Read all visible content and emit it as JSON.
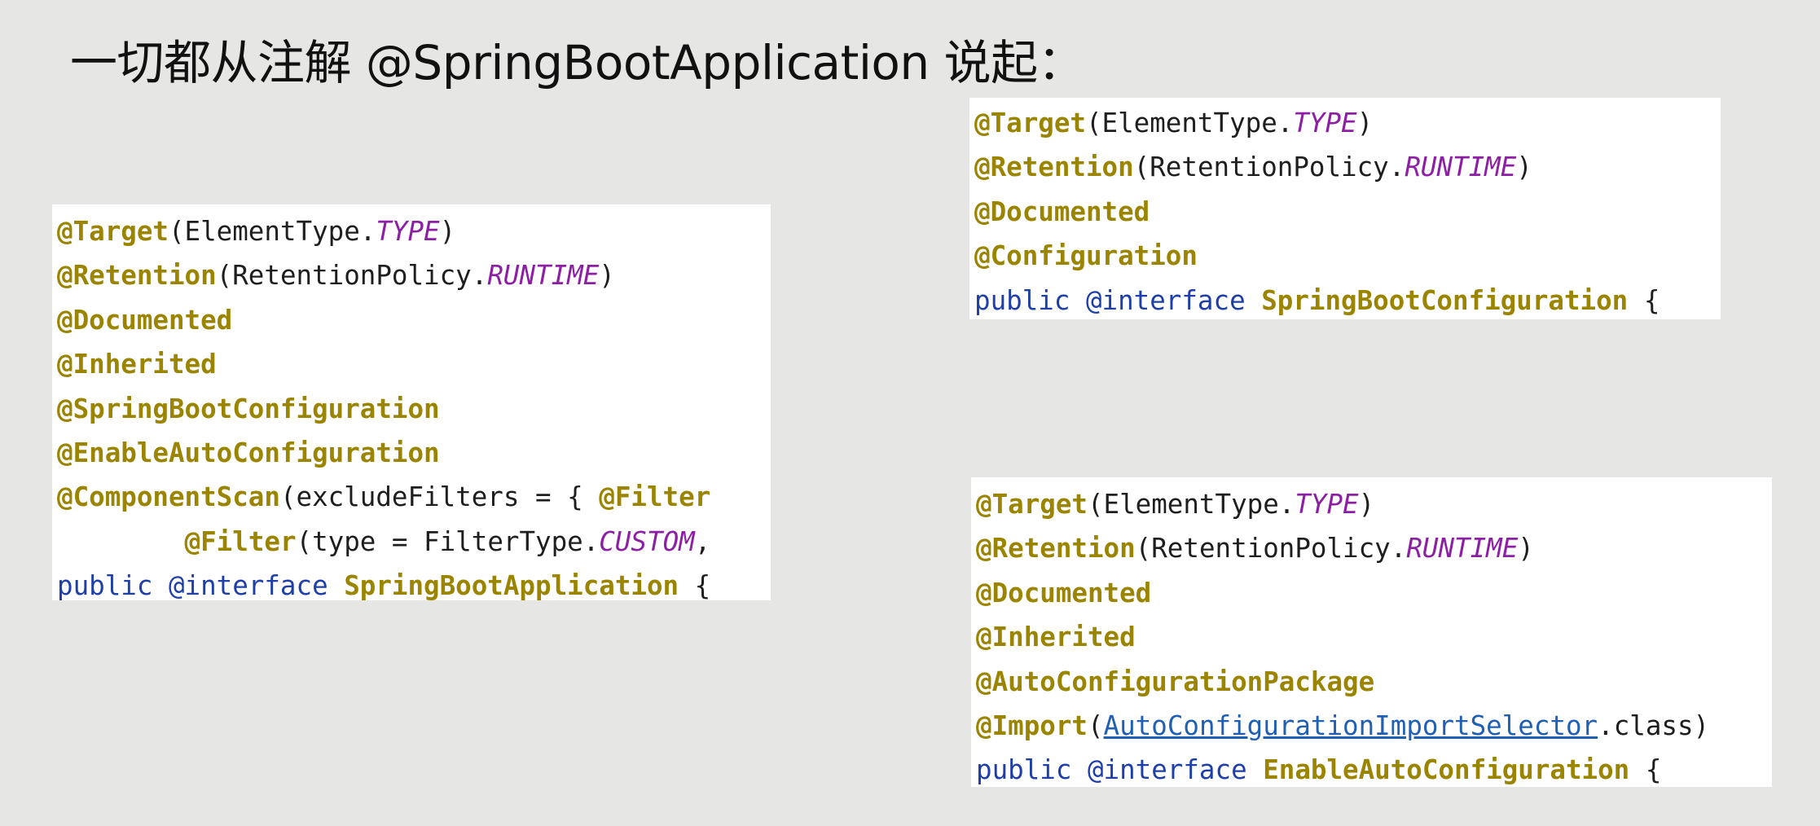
{
  "title": "一切都从注解 @SpringBootApplication 说起：",
  "panel_main": {
    "lines": [
      [
        {
          "t": "@Target",
          "c": "ann"
        },
        {
          "t": "(ElementType.",
          "c": "txt"
        },
        {
          "t": "TYPE",
          "c": "cst"
        },
        {
          "t": ")",
          "c": "txt"
        }
      ],
      [
        {
          "t": "@Retention",
          "c": "ann"
        },
        {
          "t": "(RetentionPolicy.",
          "c": "txt"
        },
        {
          "t": "RUNTIME",
          "c": "cst"
        },
        {
          "t": ")",
          "c": "txt"
        }
      ],
      [
        {
          "t": "@Documented",
          "c": "ann"
        }
      ],
      [
        {
          "t": "@Inherited",
          "c": "ann"
        }
      ],
      [
        {
          "t": "@SpringBootConfiguration",
          "c": "ann"
        }
      ],
      [
        {
          "t": "@EnableAutoConfiguration",
          "c": "ann"
        }
      ],
      [
        {
          "t": "@ComponentScan",
          "c": "ann"
        },
        {
          "t": "(excludeFilters = { ",
          "c": "txt"
        },
        {
          "t": "@Filter",
          "c": "ann"
        }
      ],
      [
        {
          "t": "        ",
          "c": "txt"
        },
        {
          "t": "@Filter",
          "c": "ann"
        },
        {
          "t": "(type = FilterType.",
          "c": "txt"
        },
        {
          "t": "CUSTOM",
          "c": "cst"
        },
        {
          "t": ",",
          "c": "txt"
        }
      ],
      [
        {
          "t": "public ",
          "c": "kw"
        },
        {
          "t": "@interface ",
          "c": "kw"
        },
        {
          "t": "SpringBootApplication",
          "c": "ann"
        },
        {
          "t": " {",
          "c": "txt"
        }
      ]
    ]
  },
  "panel_config": {
    "lines": [
      [
        {
          "t": "@Target",
          "c": "ann"
        },
        {
          "t": "(ElementType.",
          "c": "txt"
        },
        {
          "t": "TYPE",
          "c": "cst"
        },
        {
          "t": ")",
          "c": "txt"
        }
      ],
      [
        {
          "t": "@Retention",
          "c": "ann"
        },
        {
          "t": "(RetentionPolicy.",
          "c": "txt"
        },
        {
          "t": "RUNTIME",
          "c": "cst"
        },
        {
          "t": ")",
          "c": "txt"
        }
      ],
      [
        {
          "t": "@Documented",
          "c": "ann"
        }
      ],
      [
        {
          "t": "@Configuration",
          "c": "ann"
        }
      ],
      [
        {
          "t": "public ",
          "c": "kw"
        },
        {
          "t": "@interface ",
          "c": "kw"
        },
        {
          "t": "SpringBootConfiguration",
          "c": "ann"
        },
        {
          "t": " {",
          "c": "txt"
        }
      ]
    ]
  },
  "panel_auto": {
    "lines": [
      [
        {
          "t": "@Target",
          "c": "ann"
        },
        {
          "t": "(ElementType.",
          "c": "txt"
        },
        {
          "t": "TYPE",
          "c": "cst"
        },
        {
          "t": ")",
          "c": "txt"
        }
      ],
      [
        {
          "t": "@Retention",
          "c": "ann"
        },
        {
          "t": "(RetentionPolicy.",
          "c": "txt"
        },
        {
          "t": "RUNTIME",
          "c": "cst"
        },
        {
          "t": ")",
          "c": "txt"
        }
      ],
      [
        {
          "t": "@Documented",
          "c": "ann"
        }
      ],
      [
        {
          "t": "@Inherited",
          "c": "ann"
        }
      ],
      [
        {
          "t": "@AutoConfigurationPackage",
          "c": "ann"
        }
      ],
      [
        {
          "t": "@Import",
          "c": "ann"
        },
        {
          "t": "(",
          "c": "txt"
        },
        {
          "t": "AutoConfigurationImportSelector",
          "c": "lnk"
        },
        {
          "t": ".class)",
          "c": "txt"
        }
      ],
      [
        {
          "t": "public ",
          "c": "kw"
        },
        {
          "t": "@interface ",
          "c": "kw"
        },
        {
          "t": "EnableAutoConfiguration",
          "c": "ann"
        },
        {
          "t": " {",
          "c": "txt"
        }
      ]
    ]
  }
}
